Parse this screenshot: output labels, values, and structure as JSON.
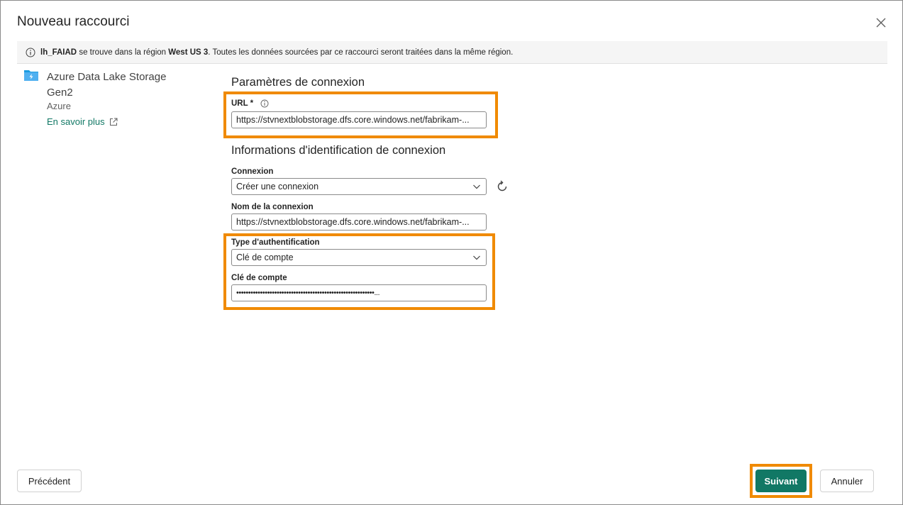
{
  "dialog": {
    "title": "Nouveau raccourci"
  },
  "info_bar": {
    "lakehouse": "lh_FAIAD",
    "text_1": " se trouve dans la région ",
    "region": "West US 3",
    "text_2": ". Toutes les données sourcées par ce raccourci seront traitées dans la même région."
  },
  "source": {
    "name": "Azure Data Lake Storage Gen2",
    "category": "Azure",
    "learn_more": "En savoir plus"
  },
  "connection_settings": {
    "heading": "Paramètres de connexion",
    "url_label": "URL *",
    "url_value": "https://stvnextblobstorage.dfs.core.windows.net/fabrikam-..."
  },
  "credentials": {
    "heading": "Informations d'identification de connexion",
    "connection_label": "Connexion",
    "connection_value": "Créer une connexion",
    "connection_name_label": "Nom de la connexion",
    "connection_name_value": "https://stvnextblobstorage.dfs.core.windows.net/fabrikam-...",
    "auth_type_label": "Type d'authentification",
    "auth_type_value": "Clé de compte",
    "account_key_label": "Clé de compte",
    "account_key_value": "••••••••••••••••••••••••••••••••••••••••••••••••••••••••••..."
  },
  "footer": {
    "back_label": "Précédent",
    "next_label": "Suivant",
    "cancel_label": "Annuler"
  },
  "colors": {
    "accent": "#117865",
    "highlight": "#f08a00"
  }
}
